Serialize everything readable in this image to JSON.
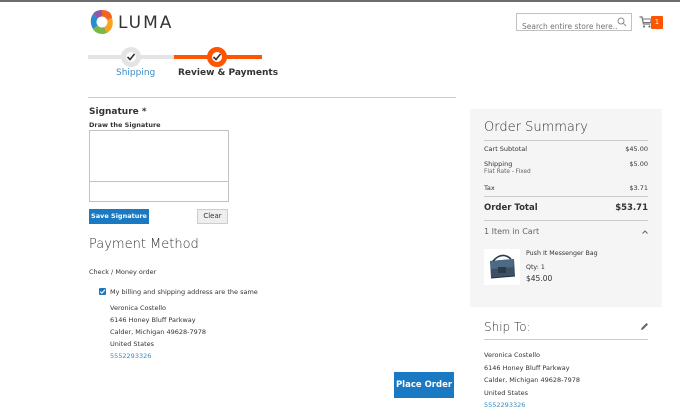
{
  "header": {
    "logo_text": "LUMA",
    "search_placeholder": "Search entire store here...",
    "cart_count": "1"
  },
  "progress": {
    "steps": [
      {
        "label": "Shipping",
        "state": "complete"
      },
      {
        "label": "Review & Payments",
        "state": "active"
      }
    ]
  },
  "signature": {
    "title": "Signature *",
    "subtitle": "Draw the Signature",
    "save_label": "Save Signature",
    "clear_label": "Clear"
  },
  "payment": {
    "title": "Payment Method",
    "option": "Check / Money order",
    "same_address_label": "My billing and shipping address are the same",
    "same_address_checked": true,
    "address": {
      "name": "Veronica Costello",
      "street": "6146 Honey Bluff Parkway",
      "city_line": "Calder, Michigan 49628-7978",
      "country": "United States",
      "phone": "5552293326"
    },
    "place_order_label": "Place Order"
  },
  "summary": {
    "title": "Order Summary",
    "cart_subtotal_label": "Cart Subtotal",
    "cart_subtotal": "$45.00",
    "shipping_label": "Shipping",
    "shipping_method": "Flat Rate - Fixed",
    "shipping_value": "$5.00",
    "tax_label": "Tax",
    "tax_value": "$3.71",
    "total_label": "Order Total",
    "total_value": "$53.71",
    "items_in_cart": "1 Item in Cart",
    "product": {
      "name": "Push It Messenger Bag",
      "qty": "Qty: 1",
      "price": "$45.00"
    }
  },
  "ship_to": {
    "title": "Ship To:",
    "name": "Veronica Costello",
    "street": "6146 Honey Bluff Parkway",
    "city_line": "Calder, Michigan 49628-7978",
    "country": "United States",
    "phone": "5552293326"
  },
  "colors": {
    "accent": "#ff5501",
    "primary_button": "#1979c3",
    "link": "#3a8cc4"
  }
}
